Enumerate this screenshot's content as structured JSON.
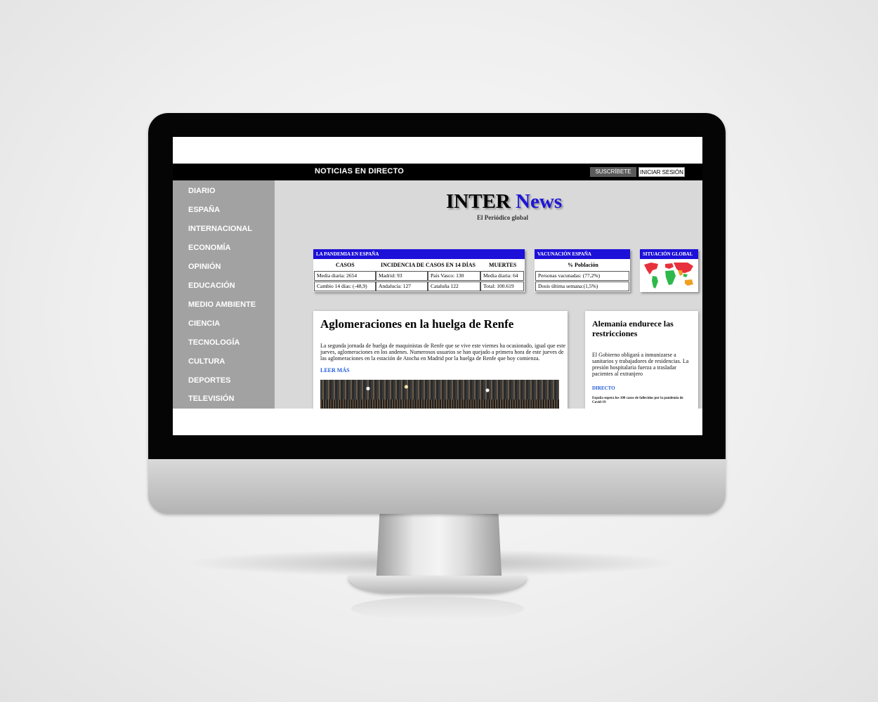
{
  "topbar": {
    "live_label": "NOTICIAS EN DIRECTO",
    "subscribe_label": "SUSCRÍBETE",
    "login_label": "INICIAR SESIÓN"
  },
  "sidebar": {
    "items": [
      {
        "label": "DIARIO"
      },
      {
        "label": "ESPAÑA"
      },
      {
        "label": "INTERNACIONAL"
      },
      {
        "label": "ECONOMÍA"
      },
      {
        "label": "OPINIÓN"
      },
      {
        "label": "EDUCACIÓN"
      },
      {
        "label": "MEDIO AMBIENTE"
      },
      {
        "label": "CIENCIA"
      },
      {
        "label": "TECNOLOGÍA"
      },
      {
        "label": "CULTURA"
      },
      {
        "label": "DEPORTES"
      },
      {
        "label": "TELEVISIÓN"
      }
    ]
  },
  "brand": {
    "name_part1": "INTER",
    "name_part2": "News",
    "tagline": "El Periódico global",
    "accent_color": "#1d16d6"
  },
  "pandemic": {
    "title": "LA PANDEMIA EN ESPAÑA",
    "headers": [
      "CASOS",
      "INCIDENCIA DE CASOS EN 14 DÍAS",
      "MUERTES"
    ],
    "rows": [
      [
        "Media diaria: 2654",
        "Madrid: 93",
        "País Vasco: 130",
        "Media diaria: 64"
      ],
      [
        "Cambio 14 días: (-48,9)",
        "Andalucía: 127",
        "Cataluña 122",
        "Total: 100.619"
      ]
    ]
  },
  "vaccination": {
    "title": "VACUNACIÓN ESPAÑA",
    "header": "% Población",
    "rows": [
      "Personas vacunadas: (77,2%)",
      "Dosis última semana:(1,5%)"
    ]
  },
  "global": {
    "title": "SITUACIÓN GLOBAL",
    "map_colors": [
      "#e8303c",
      "#2fb84a",
      "#f0a020",
      "#ffffff"
    ]
  },
  "main_article": {
    "headline": "Aglomeraciones en la huelga de Renfe",
    "body": "La segunda jornada de huelga de maquinistas de Renfe que se vive este viernes ha ocasionado, igual que este jueves, aglomeraciones en los andenes. Numerosos usuarios se han quejado a primera hora de este jueves de las aglomeraciones en la estación de Atocha en Madrid por la huelga de Renfe que hoy comienza.",
    "link": "LEER MÁS"
  },
  "side_article": {
    "headline": "Alemania endurece las restricciones",
    "body": "El Gobierno obligará a inmunizarse a sanitarios y trabajadores de residencias. La presión hospitalaria fuerza a trasladar pacientes al extranjero",
    "link": "DIRECTO",
    "subnote": "España supera los 100 casos de fallecidos por la pandemia de Covid-19"
  }
}
